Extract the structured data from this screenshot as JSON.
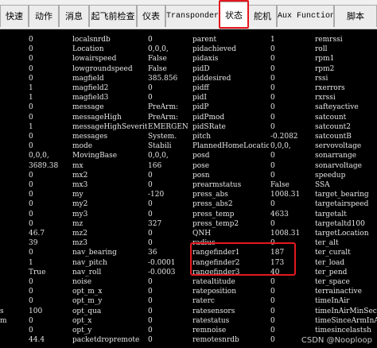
{
  "tabs": [
    {
      "label": "快速"
    },
    {
      "label": "动作"
    },
    {
      "label": "消息"
    },
    {
      "label": "起飞前检查"
    },
    {
      "label": "仪表"
    },
    {
      "label": "Transponder"
    },
    {
      "label": "状态",
      "selected": true
    },
    {
      "label": "舵机"
    },
    {
      "label": "Aux Function"
    },
    {
      "label": "脚本"
    }
  ],
  "status_rows": [
    [
      "0",
      "localsnrdb",
      "0",
      "parent",
      "1",
      "remrssi"
    ],
    [
      "0",
      "Location",
      "0,0,0,",
      "pidachieved",
      "0",
      "roll"
    ],
    [
      "0",
      "lowairspeed",
      "False",
      "pidaxis",
      "0",
      "rpm1"
    ],
    [
      "0",
      "lowgroundspeed",
      "False",
      "pidD",
      "0",
      "rpm2"
    ],
    [
      "0",
      "magfield",
      "385.856",
      "piddesired",
      "0",
      "rssi"
    ],
    [
      "1",
      "magfield2",
      "0",
      "pidff",
      "0",
      "rxerrors"
    ],
    [
      "1",
      "magfield3",
      "0",
      "pidI",
      "0",
      "rxrssi"
    ],
    [
      "0",
      "message",
      "PreArm:",
      "pidP",
      "0",
      "safteyactive"
    ],
    [
      "0",
      "messageHigh",
      "PreArm:",
      "pidPmod",
      "0",
      "satcount"
    ],
    [
      "1",
      "messageHighSeverit",
      "EMERGEN",
      "pidSRate",
      "0",
      "satcount2"
    ],
    [
      "0",
      "messages",
      "System.",
      "pitch",
      "-0.2082",
      "satcountB"
    ],
    [
      "0",
      "mode",
      "Stabili",
      "PlannedHomeLocatio",
      "0,0,0,",
      "servovoltage"
    ],
    [
      "0,0,0,",
      "MovingBase",
      "0,0,0,",
      "posd",
      "0",
      "sonarrange"
    ],
    [
      "3689.38",
      "mx",
      "166",
      "pose",
      "0",
      "sonarvoltage"
    ],
    [
      "0",
      "mx2",
      "0",
      "posn",
      "0",
      "speedup"
    ],
    [
      "0",
      "mx3",
      "0",
      "prearmstatus",
      "False",
      "SSA"
    ],
    [
      "0",
      "my",
      "-120",
      "press_abs",
      "1008.31",
      "target_bearing"
    ],
    [
      "0",
      "my2",
      "0",
      "press_abs2",
      "0",
      "targetairspeed"
    ],
    [
      "0",
      "my3",
      "0",
      "press_temp",
      "4633",
      "targetalt"
    ],
    [
      "0",
      "mz",
      "327",
      "press_temp2",
      "0",
      "targetaltd100"
    ],
    [
      "46.7",
      "mz2",
      "0",
      "QNH",
      "1008.31",
      "targetLocation"
    ],
    [
      "39",
      "mz3",
      "0",
      "radius",
      "0",
      "ter_alt"
    ],
    [
      "0",
      "nav_bearing",
      "36",
      "rangefinder1",
      "187",
      "ter_curalt"
    ],
    [
      "1",
      "nav_pitch",
      "-0.0001",
      "rangefinder2",
      "173",
      "ter_load"
    ],
    [
      "True",
      "nav_roll",
      "-0.0003",
      "rangefinder3",
      "40",
      "ter_pend"
    ],
    [
      "0",
      "noise",
      "0",
      "ratealtitude",
      "0",
      "ter_space"
    ],
    [
      "0",
      "opt_m_x",
      "0",
      "rateposition",
      "0",
      "terrainactive"
    ],
    [
      "0",
      "opt_m_y",
      "0",
      "raterc",
      "0",
      "timeInAir"
    ],
    [
      "100",
      "opt_qua",
      "0",
      "ratesensors",
      "0",
      "timeInAirMinSec"
    ],
    [
      "0",
      "opt_x",
      "0",
      "ratestatus",
      "0",
      "timeSinceArmInAir"
    ],
    [
      "0",
      "opt_y",
      "0",
      "remnoise",
      "0",
      "timesincelastsh"
    ],
    [
      "44.4",
      "packetdropremote",
      "0",
      "remotesnrdb",
      "0",
      ""
    ]
  ],
  "left_edge_marks": {
    "row28": "s",
    "row29": "m"
  },
  "watermark": "CSDN @Nooploop",
  "colors": {
    "background": "#000000",
    "text": "#e6e6e6",
    "highlight": "#e4181e"
  }
}
